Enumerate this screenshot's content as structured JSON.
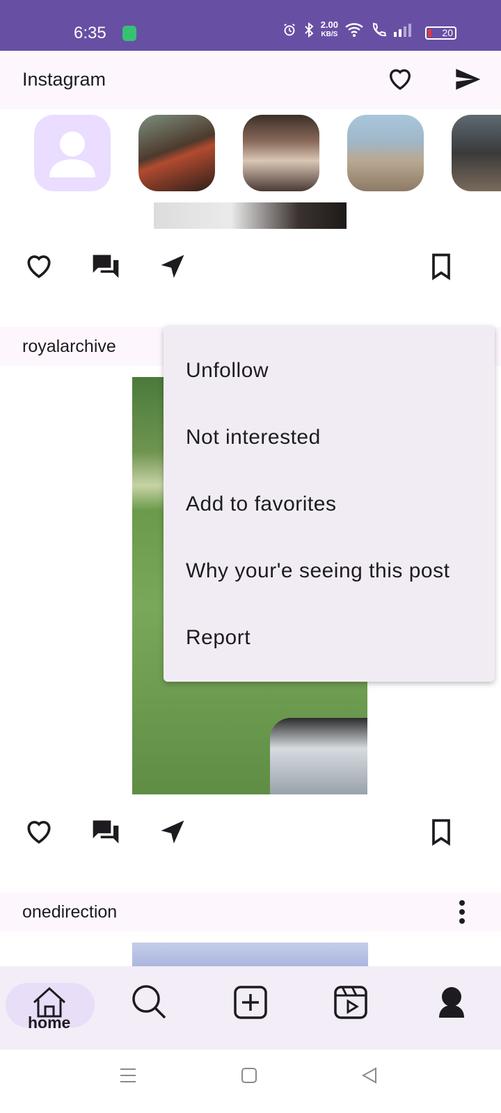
{
  "status_bar": {
    "time": "6:35",
    "speed_value": "2.00",
    "speed_unit": "KB/S",
    "battery": "20",
    "background": "#6750a4"
  },
  "app_bar": {
    "title": "Instagram",
    "icons": [
      "heart-outline-icon",
      "send-icon"
    ]
  },
  "stories": {
    "items": [
      "self-avatar",
      "story-1",
      "story-2",
      "story-3",
      "story-4"
    ]
  },
  "posts": [
    {
      "username": "",
      "actions": [
        "like",
        "comment",
        "share",
        "save"
      ]
    },
    {
      "username": "royalarchive",
      "actions": [
        "like",
        "comment",
        "share",
        "save"
      ]
    },
    {
      "username": "onedirection",
      "actions": []
    }
  ],
  "menu": {
    "items": [
      "Unfollow",
      "Not interested",
      "Add to favorites",
      "Why your'e seeing this post",
      "Report"
    ]
  },
  "bottom_nav": {
    "selected": "home",
    "home_label": "home",
    "items": [
      "home-icon",
      "search-icon",
      "add-post-icon",
      "reels-icon",
      "profile-icon"
    ]
  },
  "colors": {
    "accent": "#6750a4",
    "menu_bg": "#f1ecf4",
    "nav_bg": "#f2edf6",
    "indicator": "#e8def8"
  }
}
